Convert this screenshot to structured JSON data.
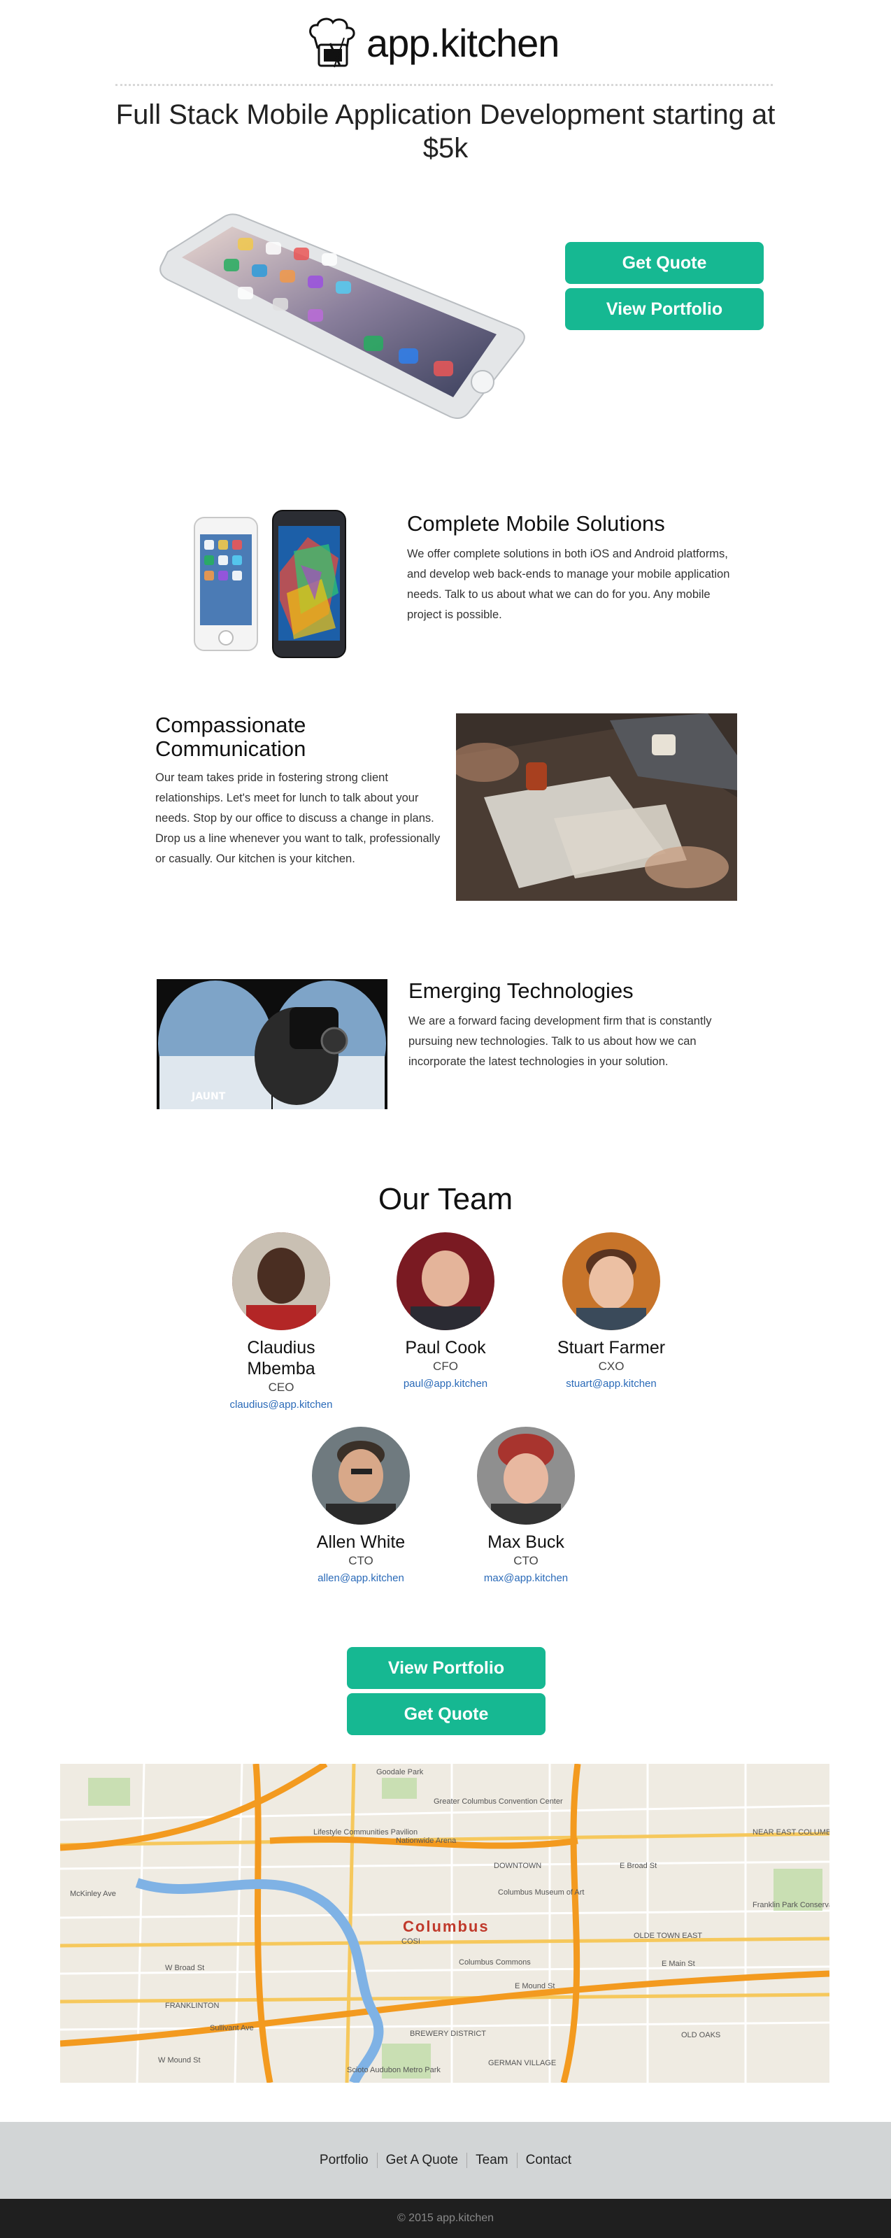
{
  "brand": {
    "name": "app.kitchen"
  },
  "headline": "Full Stack Mobile Application Development starting at $5k",
  "hero": {
    "quote_label": "Get Quote",
    "portfolio_label": "View Portfolio"
  },
  "features": [
    {
      "title": "Complete Mobile Solutions",
      "body": "We offer complete solutions in both iOS and Android platforms, and develop web back-ends to manage your mobile application needs. Talk to us about what we can do for you. Any mobile project is possible."
    },
    {
      "title": "Compassionate Communication",
      "body": "Our team takes pride in fostering strong client relationships. Let's meet for lunch to talk about your needs. Stop by our office to discuss a change in plans. Drop us a line whenever you want to talk, professionally or casually. Our kitchen is your kitchen."
    },
    {
      "title": "Emerging Technologies",
      "body": "We are a forward facing development firm that is constantly pursuing new technologies. Talk to us about how we can incorporate the latest technologies in your solution."
    }
  ],
  "team": {
    "title": "Our Team",
    "members": [
      {
        "name": "Claudius Mbemba",
        "role": "CEO",
        "email": "claudius@app.kitchen"
      },
      {
        "name": "Paul Cook",
        "role": "CFO",
        "email": "paul@app.kitchen"
      },
      {
        "name": "Stuart Farmer",
        "role": "CXO",
        "email": "stuart@app.kitchen"
      },
      {
        "name": "Allen White",
        "role": "CTO",
        "email": "allen@app.kitchen"
      },
      {
        "name": "Max Buck",
        "role": "CTO",
        "email": "max@app.kitchen"
      }
    ]
  },
  "bottom_ctas": {
    "portfolio_label": "View Portfolio",
    "quote_label": "Get Quote"
  },
  "map": {
    "city": "Columbus",
    "labels": [
      "Goodale Park",
      "Nationwide Arena",
      "Lifestyle Communities Pavilion",
      "Greater Columbus Convention Center",
      "DOWNTOWN",
      "Columbus Museum of Art",
      "COSI",
      "Columbus Commons",
      "BREWERY DISTRICT",
      "GERMAN VILLAGE",
      "OLDE TOWN EAST",
      "OLD OAKS",
      "NEAR EAST COLUMBUS",
      "FRANKLINTON",
      "W Broad St",
      "E Broad St",
      "E Main St",
      "Scioto Audubon Metro Park",
      "Franklin Park Conservatory",
      "Sullivant Ave",
      "W Mound St",
      "E Mound St",
      "McKinley Ave"
    ]
  },
  "footer": {
    "links": [
      "Portfolio",
      "Get A Quote",
      "Team",
      "Contact"
    ],
    "copyright": "© 2015 app.kitchen"
  },
  "colors": {
    "accent": "#16b892",
    "link": "#2a6ab8",
    "footer_bg": "#d2d5d6",
    "copyright_bg": "#1f1f1f"
  }
}
